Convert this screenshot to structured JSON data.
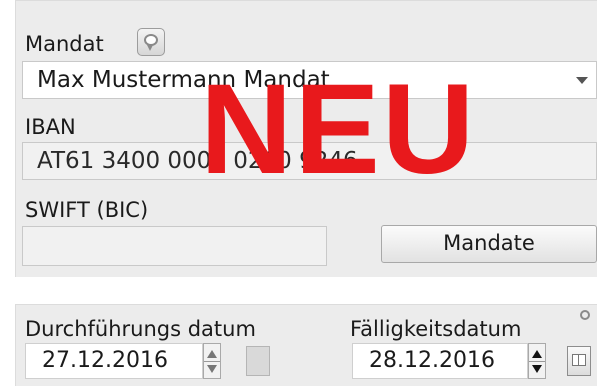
{
  "mandate_section": {
    "mandat_label": "Mandat",
    "mandat_value": "Max Mustermann Mandat",
    "iban_label": "IBAN",
    "iban_value": "AT61 3400 0000 0260 9246",
    "swift_label": "SWIFT (BIC)",
    "swift_value": "",
    "mandate_button": "Mandate"
  },
  "overlay_text": "NEU",
  "dates": {
    "execution_label": "Durchführungs datum",
    "execution_value": "27.12.2016",
    "due_label": "Fälligkeitsdatum",
    "due_value": "28.12.2016"
  },
  "icons": [
    "speech-bubble-icon",
    "dropdown-arrow-icon",
    "spinner-icon",
    "calendar-icon"
  ],
  "colors": {
    "overlay_red": "#e8191c",
    "panel_bg": "#ececec"
  }
}
